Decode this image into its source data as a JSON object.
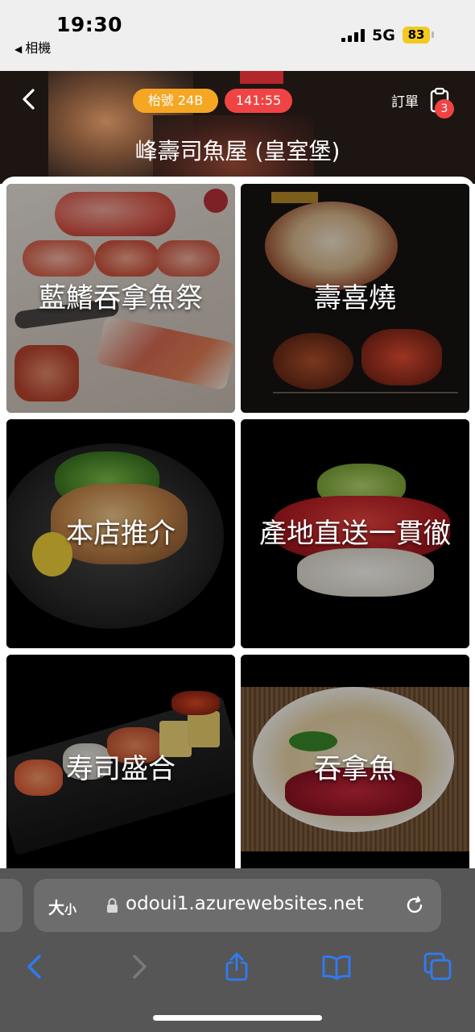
{
  "status_bar": {
    "time": "19:30",
    "back_app": "相機",
    "network": "5G",
    "battery": "83"
  },
  "header": {
    "table_badge": "枱號 24B",
    "timer_badge": "141:55",
    "order_label": "訂單",
    "order_count": "3",
    "shop_name": "峰壽司魚屋 (皇室堡)"
  },
  "categories": [
    {
      "label": "藍鰭吞拿魚祭"
    },
    {
      "label": "壽喜燒"
    },
    {
      "label": "本店推介"
    },
    {
      "label": "產地直送一貫徹"
    },
    {
      "label": "寿司盛合"
    },
    {
      "label": "吞拿魚"
    }
  ],
  "browser": {
    "text_size_big": "大",
    "text_size_small": "小",
    "url": "odoui1.azurewebsites.net"
  },
  "colors": {
    "table_badge": "#f5a623",
    "timer_badge": "#f04444",
    "toolbar_accent": "#2f7bf6",
    "browser_bar": "#565656"
  }
}
